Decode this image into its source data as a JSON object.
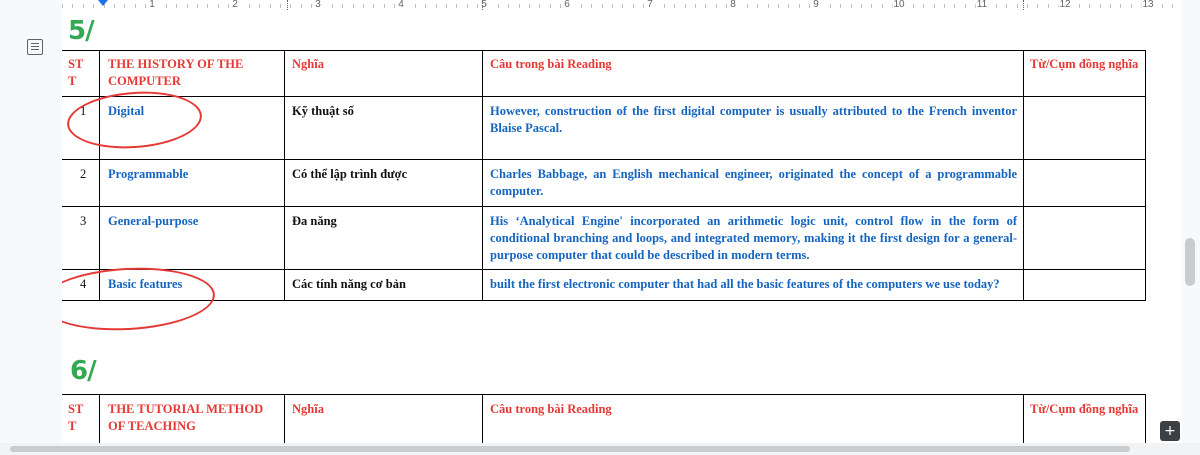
{
  "ruler": {
    "numbers": [
      "1",
      "2",
      "3",
      "4",
      "5",
      "6",
      "7",
      "8",
      "9",
      "10",
      "11",
      "12",
      "13"
    ]
  },
  "section5": {
    "number": "5/",
    "header": {
      "stt": "ST T",
      "topic": "THE HISTORY OF THE COMPUTER",
      "meaning": "Nghĩa",
      "sentence": "Câu trong bài Reading",
      "synonym": "Từ/Cụm đồng nghĩa"
    },
    "rows": [
      {
        "stt": "1",
        "term": "Digital",
        "meaning": "Kỹ thuật số",
        "sentence": "However, construction of the first digital computer is usually attributed to the French inventor Blaise Pascal.",
        "synonym": ""
      },
      {
        "stt": "2",
        "term": "Programmable",
        "meaning": "Có thể lập trình được",
        "sentence": "Charles Babbage, an English mechanical engineer, originated the concept of a programmable computer.",
        "synonym": ""
      },
      {
        "stt": "3",
        "term": "General-purpose",
        "meaning": "Đa năng",
        "sentence": "His ‘Analytical Engine' incorporated an arithmetic logic unit, control flow in the form of conditional branching and loops, and integrated memory, making it the first design for a general-purpose computer that could be described in modern terms.",
        "synonym": ""
      },
      {
        "stt": "4",
        "term": "Basic features",
        "meaning": "Các tính năng cơ bản",
        "sentence": "built the first electronic computer that had all the basic features of the computers we use today?",
        "synonym": ""
      }
    ]
  },
  "section6": {
    "number": "6/",
    "header": {
      "stt": "ST T",
      "topic": "THE TUTORIAL METHOD OF TEACHING",
      "meaning": "Nghĩa",
      "sentence": "Câu trong bài Reading",
      "synonym": "Từ/Cụm đồng nghĩa"
    }
  },
  "colors": {
    "header_red": "#e53935",
    "term_blue": "#1565c0",
    "section_green": "#34a853"
  }
}
